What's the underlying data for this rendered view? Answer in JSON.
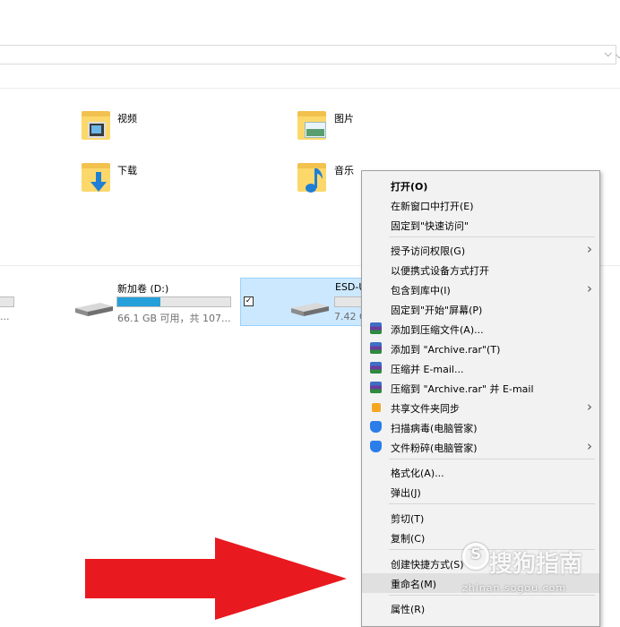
{
  "folders": [
    {
      "label": "视频"
    },
    {
      "label": "图片"
    },
    {
      "label": "下载"
    },
    {
      "label": "音乐"
    }
  ],
  "drives": [
    {
      "title": "新加卷 (D:)",
      "info": "66.1 GB 可用，共 107...",
      "used_fraction": 0.38
    },
    {
      "title": "ESD-U",
      "info": "7.42 G",
      "used_fraction": 0.0
    }
  ],
  "left_partial_info": "...",
  "context_menu": {
    "items": [
      {
        "label": "打开(O)"
      },
      {
        "label": "在新窗口中打开(E)"
      },
      {
        "label": "固定到\"快速访问\""
      },
      {
        "label": "授予访问权限(G)"
      },
      {
        "label": "以便携式设备方式打开"
      },
      {
        "label": "包含到库中(I)"
      },
      {
        "label": "固定到\"开始\"屏幕(P)"
      },
      {
        "label": "添加到压缩文件(A)..."
      },
      {
        "label": "添加到 \"Archive.rar\"(T)"
      },
      {
        "label": "压缩并 E-mail..."
      },
      {
        "label": "压缩到 \"Archive.rar\" 并 E-mail"
      },
      {
        "label": "共享文件夹同步"
      },
      {
        "label": "扫描病毒(电脑管家)"
      },
      {
        "label": "文件粉碎(电脑管家)"
      },
      {
        "label": "格式化(A)..."
      },
      {
        "label": "弹出(J)"
      },
      {
        "label": "剪切(T)"
      },
      {
        "label": "复制(C)"
      },
      {
        "label": "创建快捷方式(S)"
      },
      {
        "label": "重命名(M)"
      },
      {
        "label": "属性(R)"
      }
    ]
  },
  "watermark": {
    "text": "搜狗指南",
    "url": "zhinan.sogou.com",
    "letter": "S"
  },
  "colors": {
    "menu_bg": "#f2f2f2",
    "selection": "#cce8ff",
    "drive_fill": "#26a0da",
    "arrow": "#e8191f"
  }
}
